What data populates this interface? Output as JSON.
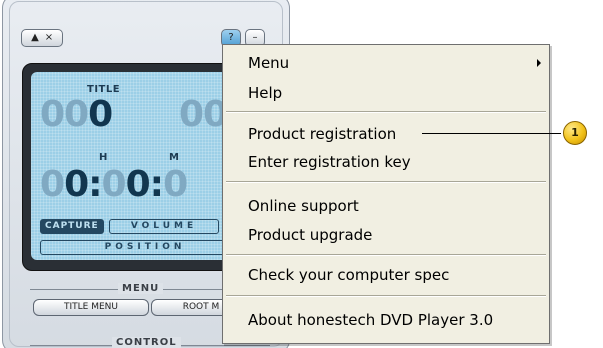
{
  "player": {
    "eject_symbol": "▲",
    "close_symbol": "×",
    "help_symbol": "?",
    "minimize_symbol": "–",
    "lcd": {
      "title_label": "TITLE",
      "title_digits_dim": "00",
      "title_digits_on": "0",
      "chapter_digits": "00",
      "hour_label": "H",
      "minute_label": "M",
      "time_dim_1": "0",
      "time_on_1": "0",
      "sep_1": ":",
      "time_dim_2": "0",
      "time_on_2": "0",
      "sep_2": ":",
      "time_dim_3": "0",
      "capture_label": "CAPTURE",
      "volume_label": "VOLUME",
      "position_label": "POSITION"
    },
    "menu_section_title": "MENU",
    "title_menu_button": "TITLE MENU",
    "root_menu_button": "ROOT M",
    "control_section_title": "CONTROL"
  },
  "context_menu": {
    "items": [
      {
        "label": "Menu",
        "has_submenu": true
      },
      {
        "label": "Help"
      },
      {
        "label": "Product registration"
      },
      {
        "label": "Enter registration key"
      },
      {
        "label": "Online support"
      },
      {
        "label": "Product upgrade"
      },
      {
        "label": "Check your computer spec"
      },
      {
        "label": "About honestech DVD Player 3.0"
      }
    ]
  },
  "callout": {
    "number": "1",
    "color": "#f2c21a"
  }
}
